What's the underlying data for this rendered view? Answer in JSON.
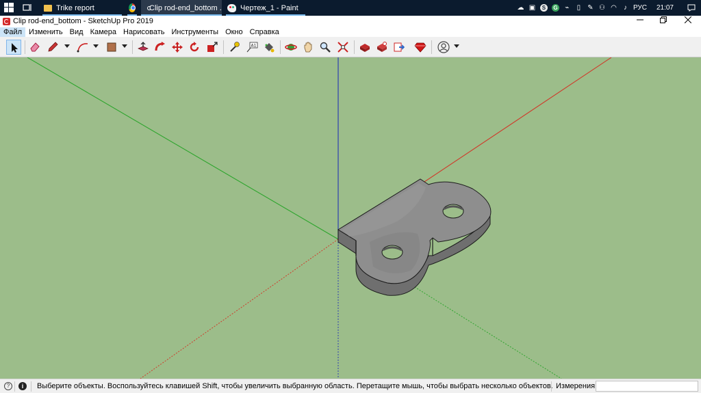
{
  "taskbar": {
    "tasks": [
      {
        "label": "Trike report",
        "icon": "folder-icon"
      },
      {
        "label": "",
        "icon": "chrome-icon"
      },
      {
        "label": "Clip rod-end_bottom ...",
        "icon": "sketchup-icon"
      },
      {
        "label": "Чертеж_1 - Paint",
        "icon": "paint-icon"
      }
    ],
    "tray": {
      "language": "РУС",
      "time": "21:07"
    }
  },
  "window": {
    "title": "Clip rod-end_bottom - SketchUp Pro 2019"
  },
  "menu": [
    "Файл",
    "Изменить",
    "Вид",
    "Камера",
    "Нарисовать",
    "Инструменты",
    "Окно",
    "Справка"
  ],
  "toolbar": {
    "tools": [
      "select-tool",
      "eraser-tool",
      "line-tool",
      "arc-tool",
      "shape-tool",
      "push-pull-tool",
      "follow-me-tool",
      "move-tool",
      "rotate-tool",
      "scale-tool",
      "tape-measure-tool",
      "text-tool",
      "paint-bucket-tool",
      "orbit-tool",
      "pan-tool",
      "zoom-tool",
      "zoom-extents-tool",
      "3d-warehouse-tool",
      "extension-warehouse-tool",
      "layout-tool",
      "extension-manager-tool",
      "account-tool"
    ]
  },
  "colors": {
    "viewport_bg": "#9cbd8a",
    "x_axis": "#d03a2a",
    "y_axis": "#2da52d",
    "z_axis": "#2d3fb0",
    "model_face": "#8a8a8a",
    "taskbar": "#0b1b2e"
  },
  "status": {
    "message": "Выберите объекты. Воспользуйтесь клавишей Shift, чтобы увеличить выбранную область. Перетащите мышь, чтобы выбрать несколько объектов.",
    "measure_label": "Измерения",
    "measure_value": ""
  }
}
